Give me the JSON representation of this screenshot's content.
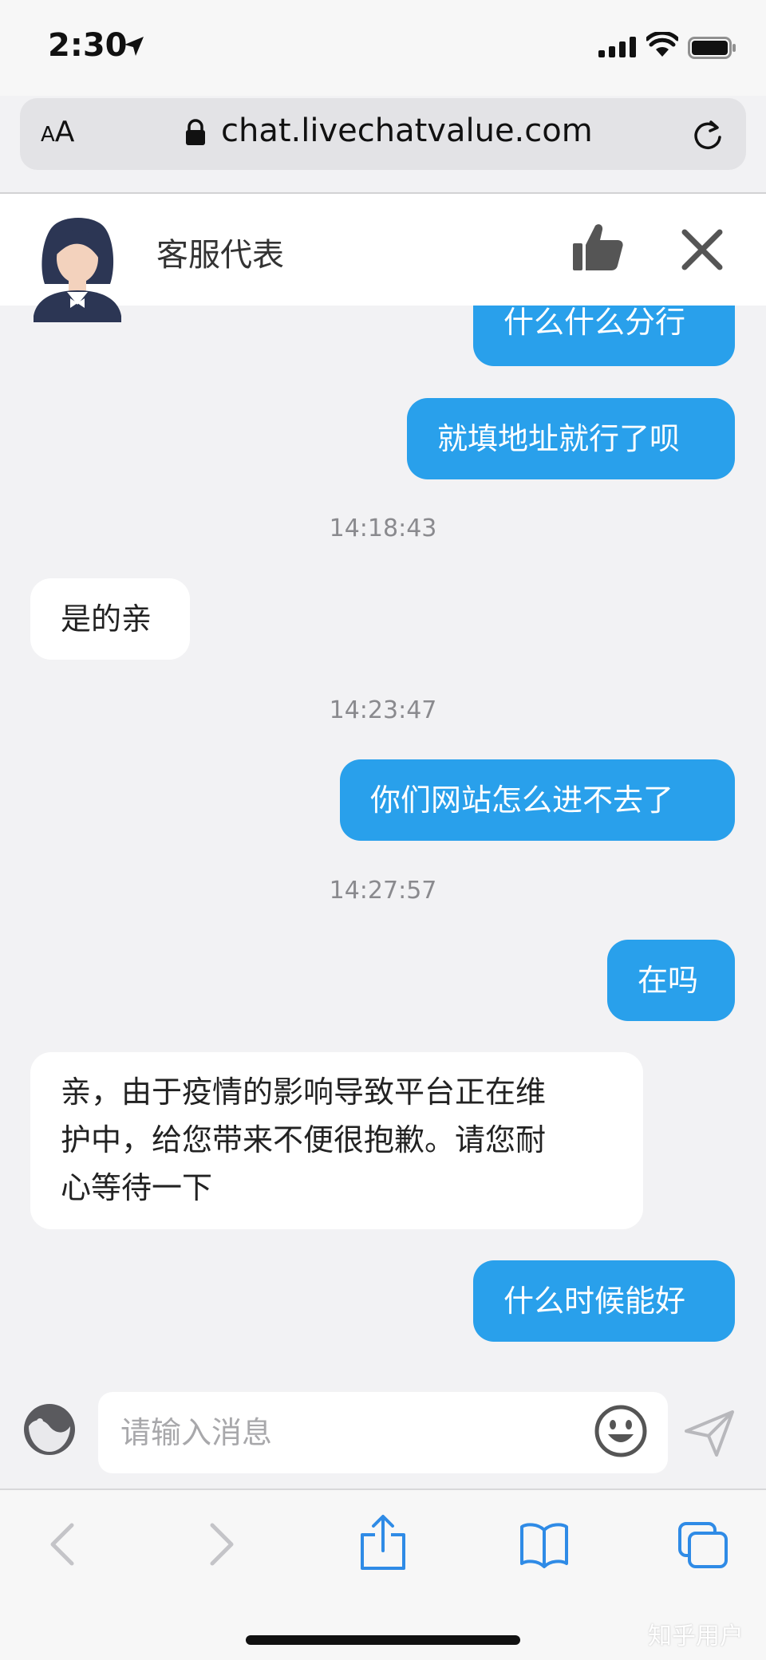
{
  "status_bar": {
    "time": "2:30",
    "icons": [
      "location-arrow-icon",
      "signal-icon",
      "wifi-icon",
      "battery-icon"
    ]
  },
  "browser": {
    "text_size_label_small": "A",
    "text_size_label_large": "A",
    "url": "chat.livechatvalue.com",
    "icons": [
      "lock-icon",
      "reload-icon"
    ]
  },
  "chat_header": {
    "agent_name": "客服代表",
    "icons": [
      "agent-avatar",
      "thumbs-up-icon",
      "close-icon"
    ]
  },
  "messages": [
    {
      "type": "outgoing",
      "text": "什么什么分行"
    },
    {
      "type": "outgoing",
      "text": "就填地址就行了呗"
    },
    {
      "type": "timestamp",
      "text": "14:18:43"
    },
    {
      "type": "incoming",
      "text": "是的亲"
    },
    {
      "type": "timestamp",
      "text": "14:23:47"
    },
    {
      "type": "outgoing",
      "text": "你们网站怎么进不去了"
    },
    {
      "type": "timestamp",
      "text": "14:27:57"
    },
    {
      "type": "outgoing",
      "text": "在吗"
    },
    {
      "type": "incoming",
      "text_lines": [
        "亲，由于疫情的影响导致平台正在维",
        "护中，给您带来不便很抱歉。请您耐",
        "心等待一下"
      ]
    },
    {
      "type": "outgoing",
      "text": "什么时候能好"
    }
  ],
  "composer": {
    "placeholder": "请输入消息",
    "icons": [
      "mood-icon",
      "emoji-icon",
      "send-icon"
    ]
  },
  "toolbar": {
    "icons": [
      "back-icon",
      "forward-icon",
      "share-icon",
      "bookmarks-icon",
      "tabs-icon"
    ],
    "back_enabled": false,
    "forward_enabled": false
  },
  "watermark": "知乎用户",
  "colors": {
    "outgoing_bubble": "#29a0eb",
    "incoming_bubble": "#ffffff",
    "toolbar_accent": "#2f8be6"
  }
}
